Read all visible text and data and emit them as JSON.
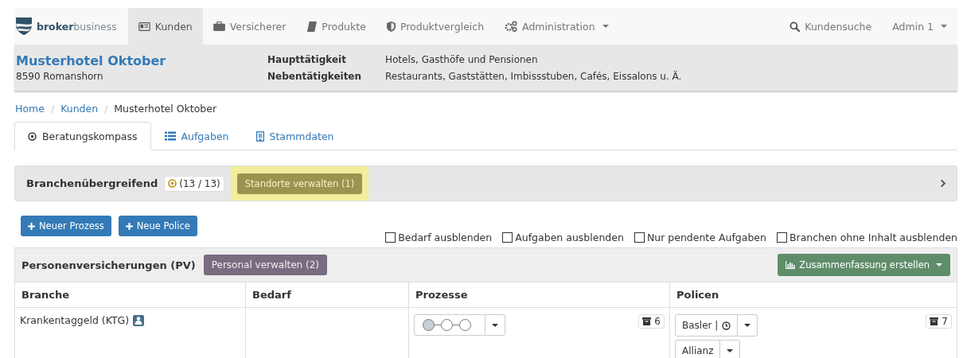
{
  "navbar": {
    "logo": {
      "bold": "broker",
      "light": "business"
    },
    "items": [
      {
        "label": "Kunden",
        "selected": true,
        "dropdown": false
      },
      {
        "label": "Versicherer",
        "selected": false,
        "dropdown": false
      },
      {
        "label": "Produkte",
        "selected": false,
        "dropdown": false
      },
      {
        "label": "Produktvergleich",
        "selected": false,
        "dropdown": false
      },
      {
        "label": "Administration",
        "selected": false,
        "dropdown": true
      }
    ],
    "right": [
      {
        "label": "Kundensuche",
        "dropdown": false
      },
      {
        "label": "Admin 1",
        "dropdown": true
      }
    ]
  },
  "customer": {
    "name": "Musterhotel Oktober",
    "city": "8590 Romanshorn",
    "fields": [
      {
        "label": "Haupttätigkeit",
        "value": "Hotels, Gasthöfe und Pensionen"
      },
      {
        "label": "Nebentätigkeiten",
        "value": "Restaurants, Gaststätten, Imbissstuben, Cafés, Eissalons u. Ä."
      }
    ]
  },
  "breadcrumb": [
    {
      "label": "Home",
      "current": false
    },
    {
      "separator": "/",
      "label": "Kunden",
      "current": false
    },
    {
      "separator": "/",
      "label": "Musterhotel Oktober",
      "current": true
    }
  ],
  "tabs": [
    {
      "label": "Beratungskompass",
      "selected": true
    },
    {
      "label": "Aufgaben",
      "selected": false
    },
    {
      "label": "Stammdaten",
      "selected": false
    }
  ],
  "cross_panel": {
    "title": "Branchenübergreifend",
    "badge": "(13 / 13)",
    "button": {
      "label": "Standorte verwalten (1)",
      "highlighted": true
    }
  },
  "actions": [
    "Neuer Prozess",
    "Neue Police"
  ],
  "filters": [
    {
      "label": "Bedarf ausblenden",
      "checked": false
    },
    {
      "label": "Aufgaben ausblenden",
      "checked": false
    },
    {
      "label": "Nur pendente Aufgaben",
      "checked": false
    },
    {
      "label": "Branchen ohne Inhalt ausblenden",
      "checked": false
    }
  ],
  "section": {
    "title": "Personenversicherungen (PV)",
    "button": "Personal verwalten (2)",
    "summary_button": "Zusammenfassung erstellen"
  },
  "table": {
    "columns": [
      "Branche",
      "Bedarf",
      "Prozesse",
      "Policen"
    ],
    "rows": [
      {
        "branche": "Krankentaggeld (KTG)",
        "person_badge": true,
        "steps": [
          {
            "filled": true
          },
          {
            "filled": false
          },
          {
            "filled": false
          }
        ],
        "process_count": "6",
        "policies": [
          {
            "label": "Basler |",
            "clock": true
          },
          {
            "label": "Allianz",
            "clock": false
          }
        ],
        "policy_count": "7"
      }
    ]
  }
}
